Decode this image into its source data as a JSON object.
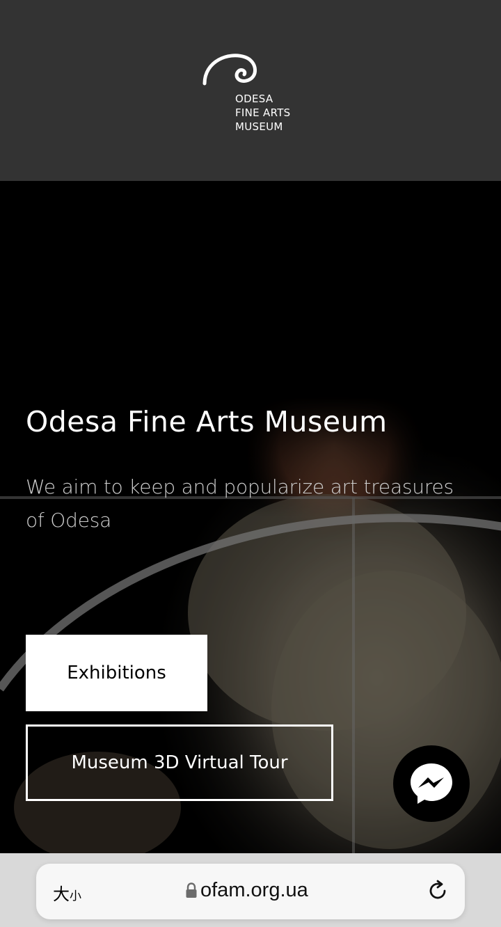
{
  "header": {
    "logo_lines": [
      "ODESA",
      "FINE ARTS",
      "MUSEUM"
    ]
  },
  "hero": {
    "title": "Odesa Fine Arts Museum",
    "subtitle": "We aim to keep and popularize art treasures of Odesa",
    "buttons": {
      "exhibitions": "Exhibitions",
      "virtual_tour": "Museum 3D Virtual Tour"
    }
  },
  "chat": {
    "icon": "messenger-icon"
  },
  "browser": {
    "text_size_label": "大",
    "text_size_small": "小",
    "url": "ofam.org.ua",
    "icons": [
      "lock-icon",
      "reload-icon"
    ]
  },
  "colors": {
    "header_bg": "#333333",
    "hero_bg": "#000000",
    "browser_bar_bg": "#d9d9d9",
    "text_light": "#ffffff"
  }
}
